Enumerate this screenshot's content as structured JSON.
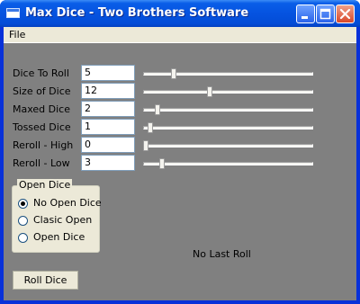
{
  "window": {
    "title": "Max Dice - Two Brothers Software"
  },
  "menu": {
    "file": "File"
  },
  "settings": [
    {
      "label": "Dice To Roll",
      "value": "5",
      "slider_level": 0.17
    },
    {
      "label": "Size of Dice",
      "value": "12",
      "slider_level": 0.39
    },
    {
      "label": "Maxed Dice",
      "value": "2",
      "slider_level": 0.07
    },
    {
      "label": "Tossed Dice",
      "value": "1",
      "slider_level": 0.03
    },
    {
      "label": "Reroll - High",
      "value": "0",
      "slider_level": 0.0
    },
    {
      "label": "Reroll - Low",
      "value": "3",
      "slider_level": 0.1
    }
  ],
  "open_dice": {
    "title": "Open Dice",
    "options": [
      "No Open Dice",
      "Clasic Open",
      "Open Dice"
    ],
    "selected": "No Open Dice"
  },
  "status": {
    "last_roll": "No Last Roll"
  },
  "actions": {
    "roll_label": "Roll Dice"
  }
}
